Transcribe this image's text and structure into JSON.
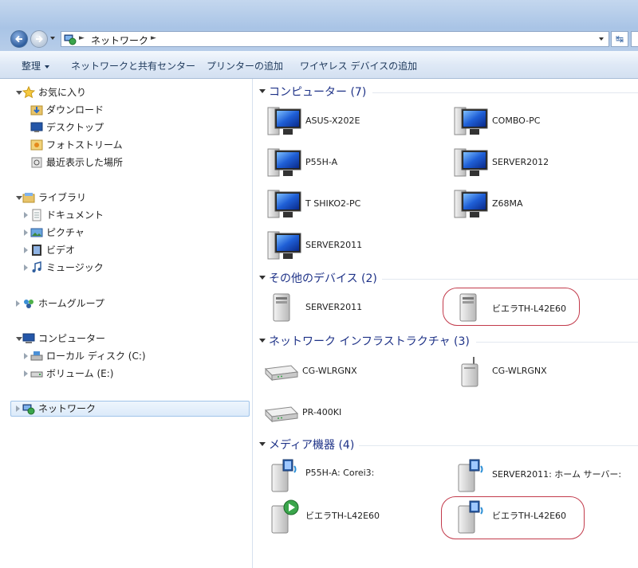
{
  "address": {
    "location": "ネットワーク"
  },
  "toolbar": {
    "organize": "整理",
    "network_center": "ネットワークと共有センター",
    "add_printer": "プリンターの追加",
    "add_wireless": "ワイヤレス デバイスの追加"
  },
  "nav": {
    "favorites": "お気に入り",
    "downloads": "ダウンロード",
    "desktop": "デスクトップ",
    "photostream": "フォトストリーム",
    "recent": "最近表示した場所",
    "libraries": "ライブラリ",
    "documents": "ドキュメント",
    "pictures": "ピクチャ",
    "videos": "ビデオ",
    "music": "ミュージック",
    "homegroup": "ホームグループ",
    "computer": "コンピューター",
    "local_disk": "ローカル ディスク (C:)",
    "volume": "ボリューム (E:)",
    "network": "ネットワーク"
  },
  "groups": {
    "computers": "コンピューター (7)",
    "other": "その他のデバイス (2)",
    "infra": "ネットワーク インフラストラクチャ (3)",
    "media": "メディア機器 (4)"
  },
  "devices": {
    "c1": "ASUS-X202E",
    "c2": "COMBO-PC",
    "c3": "P55H-A",
    "c4": "SERVER2012",
    "c5": "T  SHIKO2-PC",
    "c6": "Z68MA",
    "c7": "SERVER2011",
    "o1": "SERVER2011",
    "o2": "ビエラTH-L42E60",
    "i1": "CG-WLRGNX",
    "i2": "CG-WLRGNX",
    "i3": "PR-400KI",
    "m1": "P55H-A: Corei3:",
    "m2": "SERVER2011: ホーム サーバー:",
    "m3": "ビエラTH-L42E60",
    "m4": "ビエラTH-L42E60"
  },
  "colors": {
    "group_header": "#1e3287",
    "highlight_ring": "#c23a4b",
    "selection": "#dceafa"
  }
}
